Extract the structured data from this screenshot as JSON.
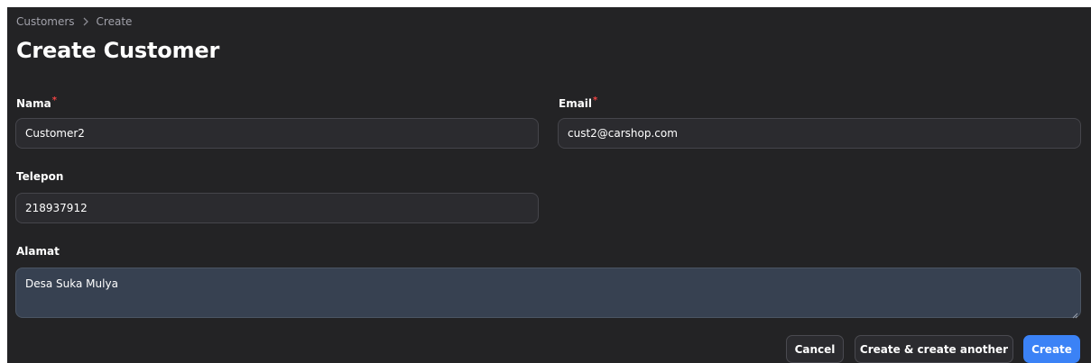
{
  "breadcrumb": {
    "items": [
      "Customers",
      "Create"
    ]
  },
  "page": {
    "title": "Create Customer"
  },
  "form": {
    "nama": {
      "label": "Nama",
      "required_mark": "*",
      "value": "Customer2"
    },
    "email": {
      "label": "Email",
      "required_mark": "*",
      "value": "cust2@carshop.com"
    },
    "telepon": {
      "label": "Telepon",
      "value": "218937912"
    },
    "alamat": {
      "label": "Alamat",
      "value": "Desa Suka Mulya"
    }
  },
  "actions": {
    "cancel_label": "Cancel",
    "create_another_label": "Create & create another",
    "create_label": "Create"
  },
  "colors": {
    "background": "#232325",
    "primary": "#3b82f6",
    "required": "#ef4444"
  }
}
